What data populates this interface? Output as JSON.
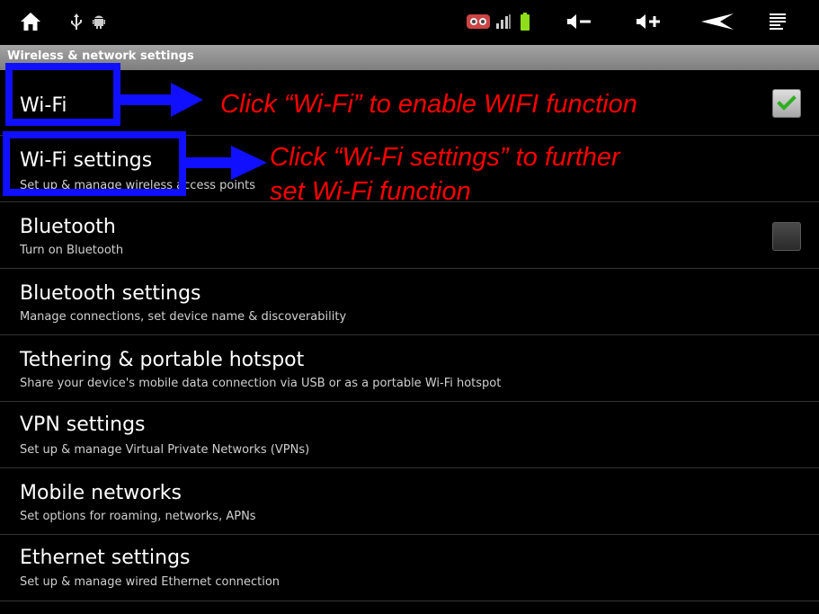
{
  "status_bar": {
    "icons": [
      "home-icon",
      "usb-icon",
      "android-debug-icon",
      "notification-icon",
      "signal-icon",
      "battery-icon",
      "volume-down-icon",
      "volume-up-icon",
      "back-icon",
      "menu-icon"
    ]
  },
  "section": {
    "title": "Wireless & network settings"
  },
  "rows": [
    {
      "title": "Wi-Fi",
      "subtitle": "",
      "checkbox": true
    },
    {
      "title": "Wi-Fi settings",
      "subtitle": "Set up & manage wireless access points"
    },
    {
      "title": "Bluetooth",
      "subtitle": "Turn on Bluetooth",
      "checkbox": false
    },
    {
      "title": "Bluetooth settings",
      "subtitle": "Manage connections, set device name & discoverability"
    },
    {
      "title": "Tethering & portable hotspot",
      "subtitle": "Share your device's mobile data connection via USB or as a portable Wi-Fi hotspot"
    },
    {
      "title": "VPN settings",
      "subtitle": "Set up & manage Virtual Private Networks (VPNs)"
    },
    {
      "title": "Mobile networks",
      "subtitle": "Set options for roaming, networks, APNs"
    },
    {
      "title": "Ethernet settings",
      "subtitle": "Set up & manage wired Ethernet connection"
    }
  ],
  "annotations": {
    "wifi_note": "Click “Wi-Fi” to enable WIFI function",
    "wifi_settings_note_line1": "Click “Wi-Fi settings” to further",
    "wifi_settings_note_line2": "set Wi-Fi function"
  },
  "colors": {
    "annotation_text": "#ff0000",
    "annotation_box": "#1010ff",
    "checkmark": "#2fae1f"
  }
}
